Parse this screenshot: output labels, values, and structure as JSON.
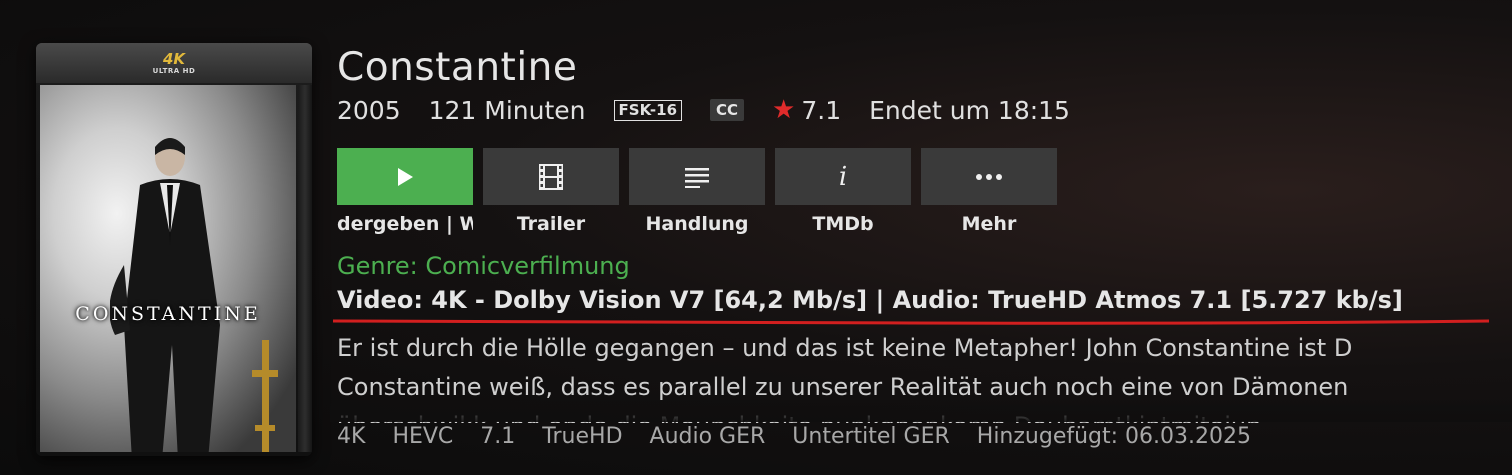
{
  "poster": {
    "badge_top": "4K",
    "badge_sub": "ULTRA HD",
    "title_art": "CONSTANTINE"
  },
  "movie": {
    "title": "Constantine",
    "year": "2005",
    "runtime": "121 Minuten",
    "age_rating": "FSK-16",
    "cc": "CC",
    "rating": "7.1",
    "ends_at": "Endet um 18:15"
  },
  "buttons": [
    {
      "label": "dergeben | W",
      "icon": "play-icon"
    },
    {
      "label": "Trailer",
      "icon": "film-icon"
    },
    {
      "label": "Handlung",
      "icon": "lines-icon"
    },
    {
      "label": "TMDb",
      "icon": "info-icon"
    },
    {
      "label": "Mehr",
      "icon": "more-icon"
    }
  ],
  "genre": "Genre: Comicverfilmung",
  "tech_line": "Video: 4K - Dolby Vision V7 [64,2 Mb/s] | Audio: TrueHD Atmos 7.1 [5.727 kb/s]",
  "description": {
    "line1": "Er ist durch die Hölle gegangen – und das ist keine Metapher! John Constantine ist D",
    "line2": "Constantine weiß, dass es parallel zu unserer Realität auch noch eine von Dämonen",
    "line3": "überschwikk und ondo dio Mounchkoito nunkgnonkomn Douhamtkintmitoiun"
  },
  "mediainfo": [
    "4K",
    "HEVC",
    "7.1",
    "TrueHD",
    "Audio GER",
    "Untertitel GER",
    "Hinzugefügt: 06.03.2025"
  ],
  "colors": {
    "accent_green": "#4caf50",
    "star_red": "#e02b2b",
    "underline_red": "#d21f1f",
    "button_gray": "#3a3a3a"
  }
}
